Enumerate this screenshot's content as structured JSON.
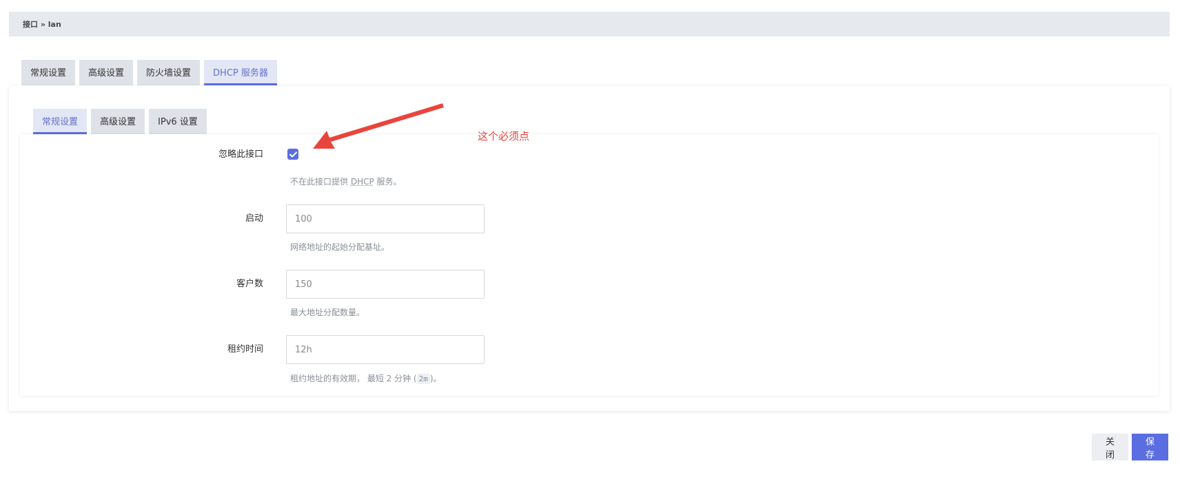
{
  "breadcrumb": "接口 » lan",
  "tabs_top": [
    {
      "label": "常规设置",
      "active": false
    },
    {
      "label": "高级设置",
      "active": false
    },
    {
      "label": "防火墙设置",
      "active": false
    },
    {
      "label": "DHCP 服务器",
      "active": true
    }
  ],
  "tabs_sub": [
    {
      "label": "常规设置",
      "active": true
    },
    {
      "label": "高级设置",
      "active": false
    },
    {
      "label": "IPv6 设置",
      "active": false
    }
  ],
  "fields": {
    "ignore": {
      "label": "忽略此接口",
      "checked": true,
      "help_prefix": "不在此接口提供 ",
      "help_abbr": "DHCP",
      "help_suffix": " 服务。"
    },
    "start": {
      "label": "启动",
      "placeholder": "100",
      "help": "网络地址的起始分配基址。"
    },
    "limit": {
      "label": "客户数",
      "placeholder": "150",
      "help": "最大地址分配数量。"
    },
    "leasetime": {
      "label": "租约时间",
      "placeholder": "12h",
      "help_prefix": "租约地址的有效期， 最短 2 分钟 (",
      "help_code": "2m",
      "help_suffix": ")。"
    }
  },
  "annotation": {
    "text": "这个必须点",
    "color": "#e8453c"
  },
  "buttons": {
    "close": "关闭",
    "save": "保存"
  },
  "colors": {
    "accent": "#5b6ee1"
  }
}
